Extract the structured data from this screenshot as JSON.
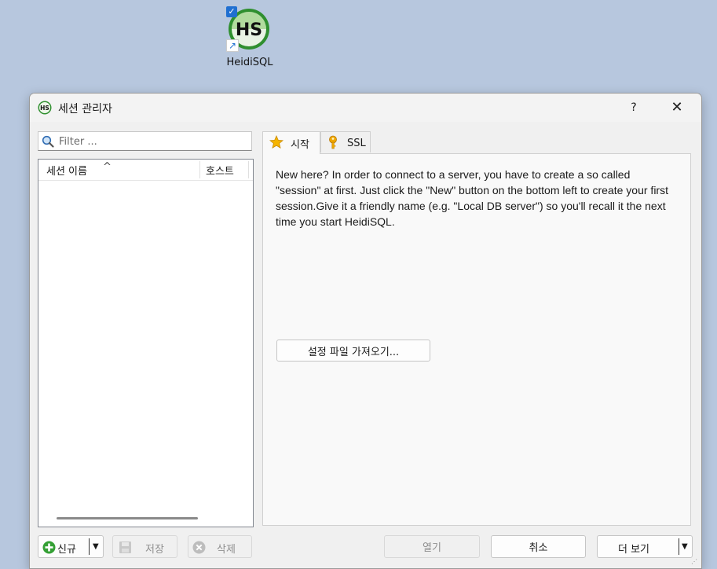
{
  "desktop": {
    "icon_label": "HeidiSQL",
    "logo_text": "HS",
    "checkbox": "✓",
    "shortcut_arrow": "↗",
    "icon_name": "heidisql-app-icon"
  },
  "dialog": {
    "title": "세션 관리자",
    "help": "?",
    "close": "✕",
    "app_icon_text": "HS"
  },
  "filter": {
    "placeholder": "Filter ..."
  },
  "session_list": {
    "columns": [
      "세션 이름",
      "호스트"
    ],
    "sort_indicator": "^"
  },
  "tabs": [
    {
      "label": "시작",
      "icon": "star-icon"
    },
    {
      "label": "SSL",
      "icon": "key-icon"
    }
  ],
  "start_tab": {
    "message": "New here? In order to connect to a server, you have to create a so called \"session\" at first. Just click the \"New\" button on the bottom left to create your first session.Give it a friendly name (e.g. \"Local DB server\") so you'll recall it the next time you start HeidiSQL.",
    "import_button": "설정 파일 가져오기..."
  },
  "buttons": {
    "new": "신규",
    "save": "저장",
    "delete": "삭제",
    "open": "열기",
    "cancel": "취소",
    "more": "더 보기"
  },
  "colors": {
    "desktop_bg": "#b7c7de",
    "accent_green": "#3aa13a",
    "accent_blue": "#1f6fd1"
  }
}
